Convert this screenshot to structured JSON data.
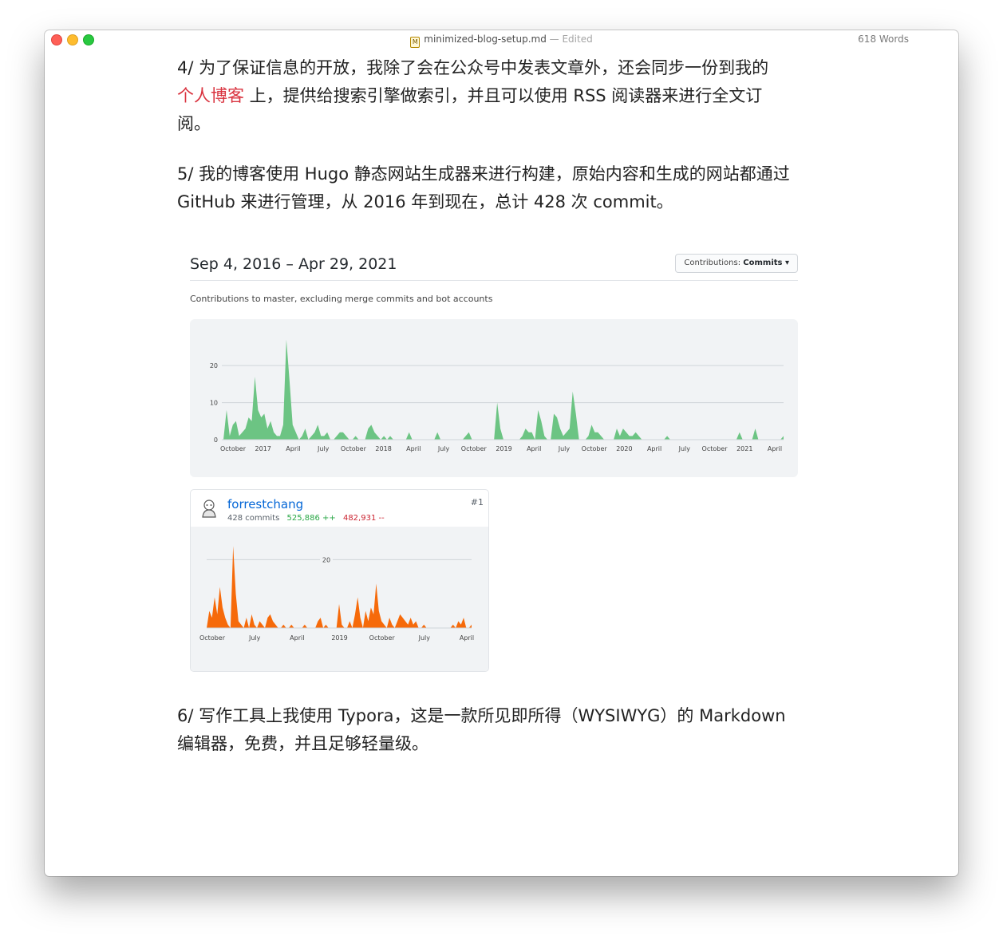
{
  "window": {
    "filename": "minimized-blog-setup.md",
    "edited_label": "— Edited",
    "word_count": "618 Words",
    "doc_icon": "markdown-file-icon"
  },
  "paragraphs": {
    "p4_line1": "4/ 为了保证信息的开放，我除了会在公众号中发表文章外，还会同步一份到我的",
    "p4_link": "个人博客",
    "p4_line2_rest": " 上，提供给搜索引擎做索引，并且可以使用 RSS 阅读器来进行全文订",
    "p4_line3": "阅。",
    "p5_line1": "5/ 我的博客使用 Hugo 静态网站生成器来进行构建，原始内容和生成的网站都通过",
    "p5_line2": "GitHub 来进行管理，从 2016 年到现在，总计 428 次 commit。",
    "p6_line1": "6/ 写作工具上我使用 Typora，这是一款所见即所得（WYSIWYG）的 Markdown",
    "p6_line2": "编辑器，免费，并且足够轻量级。"
  },
  "colors": {
    "link": "#d9333f",
    "green": "#6cc483",
    "orange": "#f66a0a",
    "add": "#28a745",
    "del": "#cb2431"
  },
  "github": {
    "date_range": "Sep 4, 2016 – Apr 29, 2021",
    "select_prefix": "Contributions: ",
    "select_value": "Commits ▾",
    "subtitle": "Contributions to master, excluding merge commits and bot accounts",
    "user": {
      "name": "forrestchang",
      "commits": "428 commits",
      "additions": "525,886 ++",
      "deletions": "482,931 --",
      "rank": "#1",
      "avatar_icon": "octocat-avatar-icon"
    }
  },
  "chart_data": [
    {
      "type": "area",
      "title": "",
      "xlabel": "",
      "ylabel": "",
      "ylim": [
        0,
        28
      ],
      "yticks": [
        0,
        10,
        20
      ],
      "grid": true,
      "x_tick_labels": [
        "October",
        "2017",
        "April",
        "July",
        "October",
        "2018",
        "April",
        "July",
        "October",
        "2019",
        "April",
        "July",
        "October",
        "2020",
        "April",
        "July",
        "October",
        "2021",
        "April"
      ],
      "series": [
        {
          "values": [
            0,
            8,
            1,
            4,
            5,
            1,
            2,
            3,
            6,
            5,
            17,
            8,
            6,
            7,
            3,
            5,
            2,
            1,
            1,
            4,
            27,
            16,
            4,
            2,
            0,
            1,
            3,
            0,
            1,
            2,
            4,
            1,
            1,
            2,
            0,
            0,
            1,
            2,
            2,
            1,
            0,
            0,
            1,
            0,
            0,
            0,
            3,
            4,
            2,
            1,
            0,
            1,
            0,
            1,
            0,
            0,
            0,
            0,
            0,
            2,
            0,
            0,
            0,
            0,
            0,
            0,
            0,
            0,
            2,
            0,
            0,
            0,
            0,
            0,
            0,
            0,
            0,
            1,
            2,
            0,
            0,
            0,
            0,
            0,
            0,
            0,
            0,
            10,
            3,
            0,
            0,
            0,
            0,
            0,
            0,
            1,
            3,
            2,
            2,
            0,
            8,
            5,
            1,
            0,
            0,
            7,
            6,
            3,
            1,
            2,
            3,
            13,
            7,
            0,
            0,
            0,
            1,
            4,
            2,
            2,
            1,
            0,
            0,
            0,
            0,
            3,
            1,
            3,
            2,
            1,
            1,
            2,
            1,
            0,
            0,
            0,
            0,
            0,
            0,
            0,
            0,
            1,
            0,
            0,
            0,
            0,
            0,
            0,
            0,
            0,
            0,
            0,
            0,
            0,
            0,
            0,
            0,
            0,
            0,
            0,
            0,
            0,
            0,
            0,
            2,
            0,
            0,
            0,
            0,
            3,
            0,
            0,
            0,
            0,
            0,
            0,
            0,
            0,
            1
          ]
        }
      ]
    },
    {
      "type": "area",
      "title": "",
      "xlabel": "",
      "ylabel": "",
      "ylim": [
        0,
        25
      ],
      "yticks": [
        20
      ],
      "grid": true,
      "x_tick_labels": [
        "October",
        "July",
        "April",
        "2019",
        "October",
        "July",
        "April"
      ],
      "series": [
        {
          "name": "forrestchang",
          "values": [
            0,
            5,
            3,
            9,
            4,
            12,
            6,
            3,
            1,
            0,
            24,
            10,
            2,
            1,
            0,
            3,
            0,
            4,
            1,
            0,
            2,
            1,
            0,
            3,
            4,
            2,
            1,
            0,
            0,
            1,
            0,
            0,
            1,
            0,
            0,
            0,
            0,
            1,
            0,
            0,
            0,
            0,
            2,
            3,
            0,
            1,
            0,
            0,
            0,
            0,
            7,
            1,
            0,
            0,
            2,
            0,
            4,
            9,
            3,
            0,
            5,
            2,
            6,
            4,
            13,
            5,
            2,
            1,
            0,
            3,
            1,
            0,
            2,
            4,
            3,
            2,
            1,
            3,
            1,
            2,
            0,
            0,
            1,
            0,
            0,
            0,
            0,
            0,
            0,
            0,
            0,
            0,
            0,
            1,
            0,
            2,
            1,
            3,
            0,
            0,
            1
          ]
        }
      ]
    }
  ]
}
